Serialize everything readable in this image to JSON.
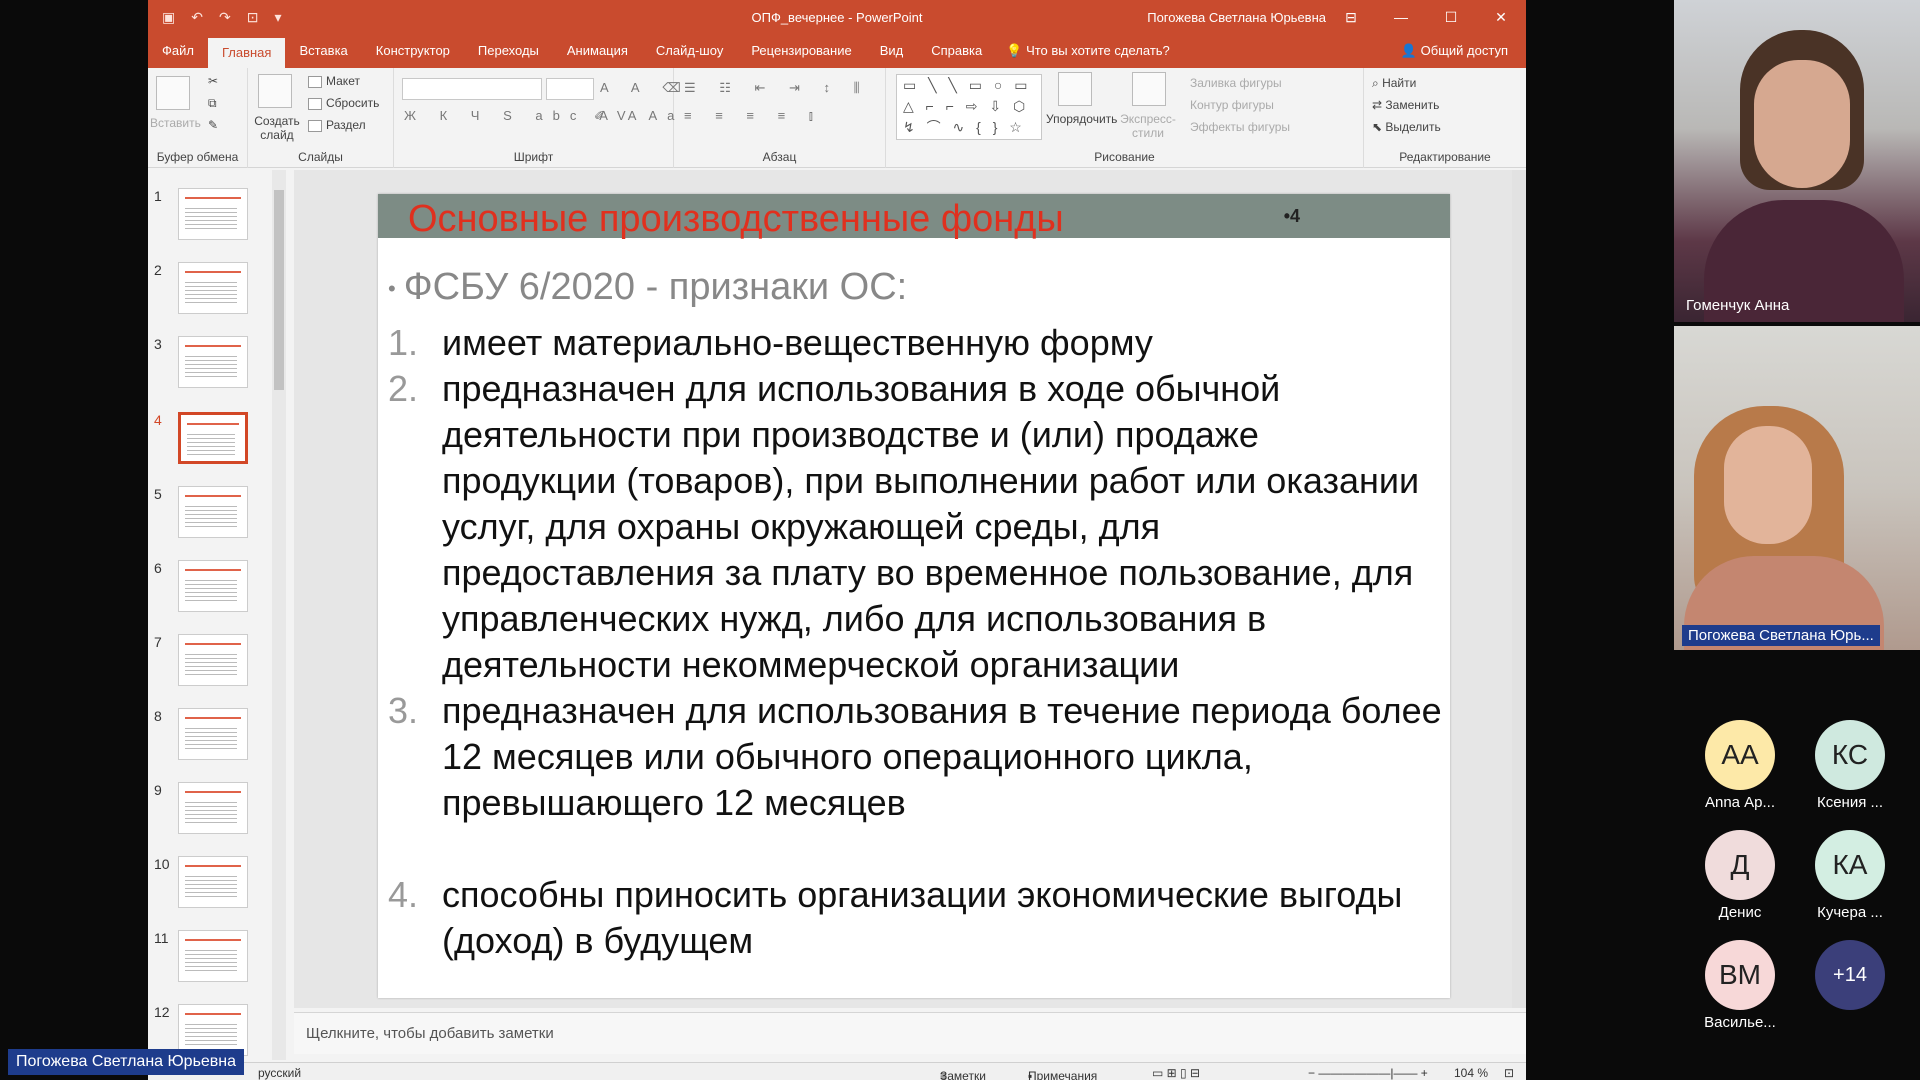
{
  "window": {
    "title": "ОПФ_вечернее - PowerPoint",
    "user": "Погожева Светлана Юрьевна"
  },
  "tabs": [
    "Файл",
    "Главная",
    "Вставка",
    "Конструктор",
    "Переходы",
    "Анимация",
    "Слайд-шоу",
    "Рецензирование",
    "Вид",
    "Справка"
  ],
  "tell_me": "Что вы хотите сделать?",
  "share": "Общий доступ",
  "ribbon": {
    "clipboard": {
      "paste": "Вставить",
      "label": "Буфер обмена"
    },
    "slides": {
      "new_slide": "Создать слайд",
      "layout": "Макет",
      "reset": "Сбросить",
      "section": "Раздел",
      "label": "Слайды"
    },
    "font": {
      "label": "Шрифт"
    },
    "paragraph": {
      "label": "Абзац"
    },
    "drawing": {
      "arrange": "Упорядочить",
      "quick_styles": "Экспресс-стили",
      "fill": "Заливка фигуры",
      "outline": "Контур фигуры",
      "effects": "Эффекты фигуры",
      "label": "Рисование"
    },
    "editing": {
      "find": "Найти",
      "replace": "Заменить",
      "select": "Выделить",
      "label": "Редактирование"
    }
  },
  "thumbnails": [
    "1",
    "2",
    "3",
    "4",
    "5",
    "6",
    "7",
    "8",
    "9",
    "10",
    "11",
    "12"
  ],
  "selected_slide": "4",
  "slide": {
    "title": "Основные производственные фонды",
    "number": "•4",
    "subheading": "ФСБУ 6/2020 - признаки ОС:",
    "items": [
      {
        "n": "1.",
        "text": "имеет материально-вещественную форму"
      },
      {
        "n": "2.",
        "text": "предназначен для использования в ходе обычной деятельности при производстве и (или) продаже продукции (товаров), при выполнении работ или оказании услуг, для охраны окружающей среды, для предоставления за плату во временное пользование, для управленческих нужд, либо для использования в деятельности некоммерческой организации"
      },
      {
        "n": "3.",
        "text": "предназначен для использования в течение периода более 12 месяцев или обычного операционного цикла, превышающего 12 месяцев"
      },
      {
        "n": "4.",
        "text": "способны приносить организации экономические выгоды (доход) в будущем"
      }
    ]
  },
  "notes_placeholder": "Щелкните, чтобы добавить заметки",
  "status": {
    "language": "русский",
    "notes": "Заметки",
    "comments": "Примечания",
    "zoom": "104 %"
  },
  "presenter_label": "Погожева Светлана Юрьевна",
  "videos": [
    {
      "name": "Гоменчук Анна"
    },
    {
      "name": "Погожева Светлана Юрь..."
    }
  ],
  "participants": [
    {
      "initials": "АА",
      "name": "Anna Ар...",
      "color": "#fde9a8"
    },
    {
      "initials": "КС",
      "name": "Ксения ...",
      "color": "#cfe9df"
    },
    {
      "initials": "Д",
      "name": "Денис",
      "color": "#f0dcdc"
    },
    {
      "initials": "КА",
      "name": "Кучера ...",
      "color": "#d3eee2"
    },
    {
      "initials": "ВМ",
      "name": "Васильe...",
      "color": "#f7d8d8"
    },
    {
      "initials": "+14",
      "name": "",
      "color": "#3b3f7a"
    }
  ]
}
